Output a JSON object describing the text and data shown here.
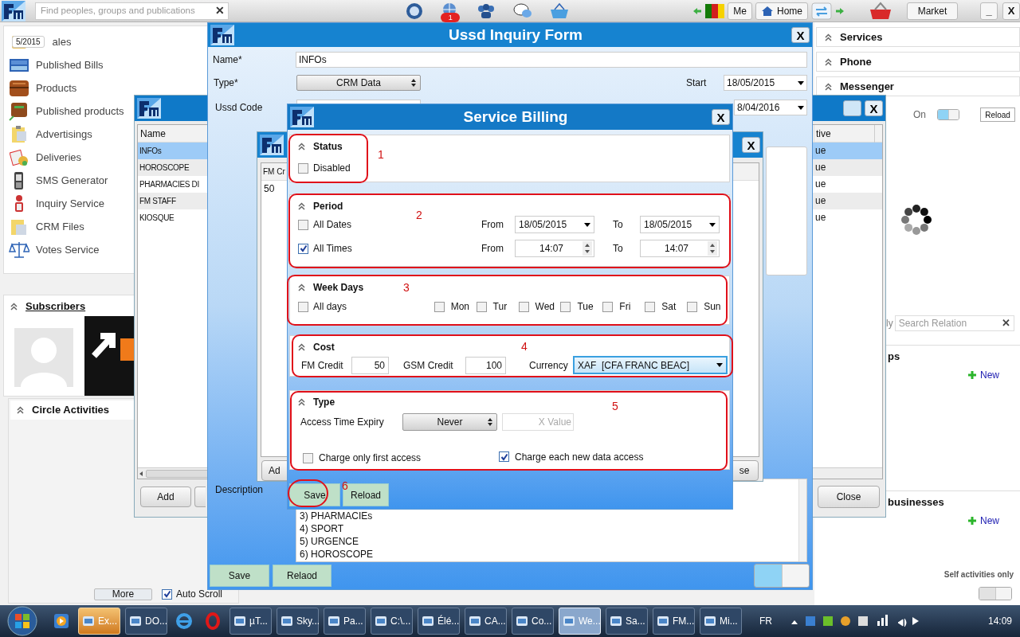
{
  "top_bar": {
    "search": {
      "placeholder": "Find peoples, groups and publications",
      "clear": "✕"
    },
    "notification_count": "1",
    "me": "Me",
    "home": "Home",
    "market": "Market",
    "minimize": "_",
    "close": "X"
  },
  "left_menu": {
    "date_tag": "5/2015",
    "items": [
      "ales",
      "Published Bills",
      "Products",
      "Published products",
      "Advertisings",
      "Deliveries",
      "SMS Generator",
      "Inquiry Service",
      "CRM Files",
      "Votes Service"
    ]
  },
  "subscribers": {
    "title": "Subscribers"
  },
  "circle_activities": {
    "title": "Circle Activities",
    "more": "More",
    "auto_scroll": {
      "label": "Auto Scroll",
      "checked": true
    }
  },
  "right_panel": {
    "sections": [
      "Services",
      "Phone",
      "Messenger"
    ],
    "status_label": "On",
    "status_toggle": {
      "on": true
    },
    "reload": "Reload",
    "search_prefix": "ly",
    "search": {
      "placeholder": "Search Relation",
      "clear": "✕"
    },
    "groups": [
      {
        "title": "ps",
        "new": "New"
      },
      {
        "title": "businesses",
        "new": "New"
      }
    ],
    "self_activities": {
      "label": "Self activities only",
      "on": false
    }
  },
  "list_window": {
    "close": "X",
    "columns": [
      "Name",
      "tive"
    ],
    "rows": [
      {
        "name": "INFOs",
        "active": "ue",
        "selected": true
      },
      {
        "name": "HOROSCOPE",
        "active": "ue",
        "selected": false
      },
      {
        "name": "PHARMACIES DI",
        "active": "ue",
        "selected": false
      },
      {
        "name": "FM STAFF",
        "active": "ue",
        "selected": false
      },
      {
        "name": "KIOSQUE",
        "active": "ue",
        "selected": false
      }
    ],
    "add": "Add",
    "close_button": "Close"
  },
  "ussd_form": {
    "title": "Ussd Inquiry Form",
    "close": "X",
    "name_label": "Name*",
    "name": "INFOs",
    "type_label": "Type*",
    "type": "CRM Data",
    "start_label": "Start",
    "start": "18/05/2015",
    "code_label": "Ussd Code",
    "end": "8/04/2016",
    "description_label": "Description",
    "description_lines": [
      "3) PHARMACIEs",
      "4) SPORT",
      "5) URGENCE",
      "6) HOROSCOPE"
    ],
    "buttons": [
      "Save",
      "Relaod"
    ],
    "toggle": {
      "on": true
    }
  },
  "inner_window": {
    "close": "X",
    "column": "FM Cr",
    "value": "50",
    "left_button": "Ad",
    "right_button": "se"
  },
  "service_billing": {
    "title": "Service Billing",
    "close": "X",
    "status": {
      "title": "Status",
      "annotation": "1",
      "disabled": {
        "label": "Disabled",
        "checked": false
      }
    },
    "period": {
      "title": "Period",
      "annotation": "2",
      "rows": [
        {
          "kind": "date",
          "label": "All Dates",
          "checked": false,
          "from_label": "From",
          "from": "18/05/2015",
          "to_label": "To",
          "to": "18/05/2015"
        },
        {
          "kind": "time",
          "label": "All Times",
          "checked": true,
          "from_label": "From",
          "from": "14:07",
          "to_label": "To",
          "to": "14:07"
        }
      ]
    },
    "week_days": {
      "title": "Week Days",
      "annotation": "3",
      "all": {
        "label": "All days",
        "checked": false
      },
      "days": [
        {
          "label": "Mon",
          "checked": false
        },
        {
          "label": "Tur",
          "checked": false
        },
        {
          "label": "Wed",
          "checked": false
        },
        {
          "label": "Tue",
          "checked": false
        },
        {
          "label": "Fri",
          "checked": false
        },
        {
          "label": "Sat",
          "checked": false
        },
        {
          "label": "Sun",
          "checked": false
        }
      ]
    },
    "cost": {
      "title": "Cost",
      "annotation": "4",
      "fm_credit_label": "FM Credit",
      "fm_credit": "50",
      "gsm_credit_label": "GSM Credit",
      "gsm_credit": "100",
      "currency_label": "Currency",
      "currency": "XAF  [CFA FRANC BEAC]"
    },
    "type": {
      "title": "Type",
      "annotation": "5",
      "expiry_label": "Access Time Expiry",
      "expiry": "Never",
      "x_value_placeholder": "X Value",
      "options": [
        {
          "label": "Charge only first access",
          "checked": false
        },
        {
          "label": "Charge each new data access",
          "checked": true
        }
      ]
    },
    "save": "Save",
    "save_annotation": "6",
    "reload": "Reload"
  },
  "taskbar": {
    "items": [
      {
        "kind": "icon",
        "selected": false
      },
      {
        "kind": "app",
        "label": "Ex...",
        "selected": false,
        "attention": true
      },
      {
        "kind": "app",
        "label": "DO...",
        "selected": false,
        "attention": false
      },
      {
        "kind": "icon",
        "selected": false
      },
      {
        "kind": "icon",
        "selected": false
      },
      {
        "kind": "app",
        "label": "µT...",
        "selected": false,
        "attention": false
      },
      {
        "kind": "app",
        "label": "Sky...",
        "selected": false,
        "attention": false
      },
      {
        "kind": "app",
        "label": "Pa...",
        "selected": false,
        "attention": false
      },
      {
        "kind": "app",
        "label": "C:\\...",
        "selected": false,
        "attention": false
      },
      {
        "kind": "app",
        "label": "Élé...",
        "selected": false,
        "attention": false
      },
      {
        "kind": "app",
        "label": "CA...",
        "selected": false,
        "attention": false
      },
      {
        "kind": "app",
        "label": "Co...",
        "selected": false,
        "attention": false
      },
      {
        "kind": "app",
        "label": "We...",
        "selected": true,
        "attention": false
      },
      {
        "kind": "app",
        "label": "Sa...",
        "selected": false,
        "attention": false
      },
      {
        "kind": "app",
        "label": "FM...",
        "selected": false,
        "attention": false
      },
      {
        "kind": "app",
        "label": "Mi...",
        "selected": false,
        "attention": false
      }
    ],
    "language": "FR",
    "clock": "14:09"
  }
}
